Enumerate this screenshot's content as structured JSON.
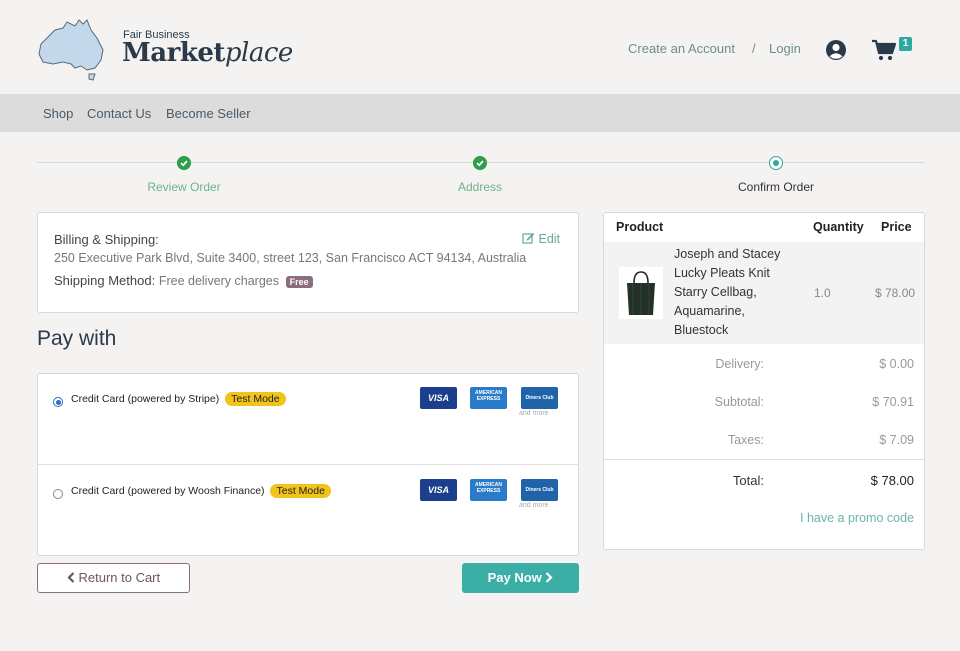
{
  "header": {
    "logo_small": "Fair Business",
    "logo_market": "Market",
    "logo_place": "place",
    "create_account": "Create an Account",
    "separator": "/",
    "login": "Login",
    "cart_count": "1"
  },
  "nav": {
    "items": [
      "Shop",
      "Contact Us",
      "Become Seller"
    ]
  },
  "steps": [
    {
      "label": "Review Order",
      "state": "done"
    },
    {
      "label": "Address",
      "state": "done"
    },
    {
      "label": "Confirm Order",
      "state": "current"
    }
  ],
  "billing": {
    "label": "Billing & Shipping:",
    "address": "250 Executive Park Blvd, Suite 3400, street 123, San Francisco ACT 94134, Australia",
    "shipping_label": "Shipping Method:",
    "shipping_value": "Free delivery charges",
    "free_badge": "Free",
    "edit_label": "Edit"
  },
  "pay_with_title": "Pay with",
  "payment_methods": [
    {
      "label": "Credit Card (powered by Stripe)",
      "badge": "Test Mode",
      "selected": true,
      "cards": [
        "VISA",
        "AMERICAN EXPRESS",
        "Diners Club"
      ],
      "and_more": "and more"
    },
    {
      "label": "Credit Card (powered by Woosh Finance)",
      "badge": "Test Mode",
      "selected": false,
      "cards": [
        "VISA",
        "AMERICAN EXPRESS",
        "Diners Club"
      ],
      "and_more": "and more"
    }
  ],
  "buttons": {
    "back": "Return to Cart",
    "pay": "Pay Now"
  },
  "summary": {
    "headers": {
      "product": "Product",
      "quantity": "Quantity",
      "price": "Price"
    },
    "item": {
      "name": "Joseph and Stacey Lucky Pleats Knit Starry Cellbag, Aquamarine, Bluestock",
      "quantity": "1.0",
      "price": "$ 78.00"
    },
    "delivery_label": "Delivery:",
    "delivery_value": "$ 0.00",
    "subtotal_label": "Subtotal:",
    "subtotal_value": "$ 70.91",
    "taxes_label": "Taxes:",
    "taxes_value": "$ 7.09",
    "total_label": "Total:",
    "total_value": "$ 78.00",
    "promo": "I have a promo code"
  },
  "colors": {
    "accent": "#3bafa6",
    "done": "#2e9e4d",
    "badge": "#f2c31a",
    "brand_dark": "#2b3a4a"
  }
}
